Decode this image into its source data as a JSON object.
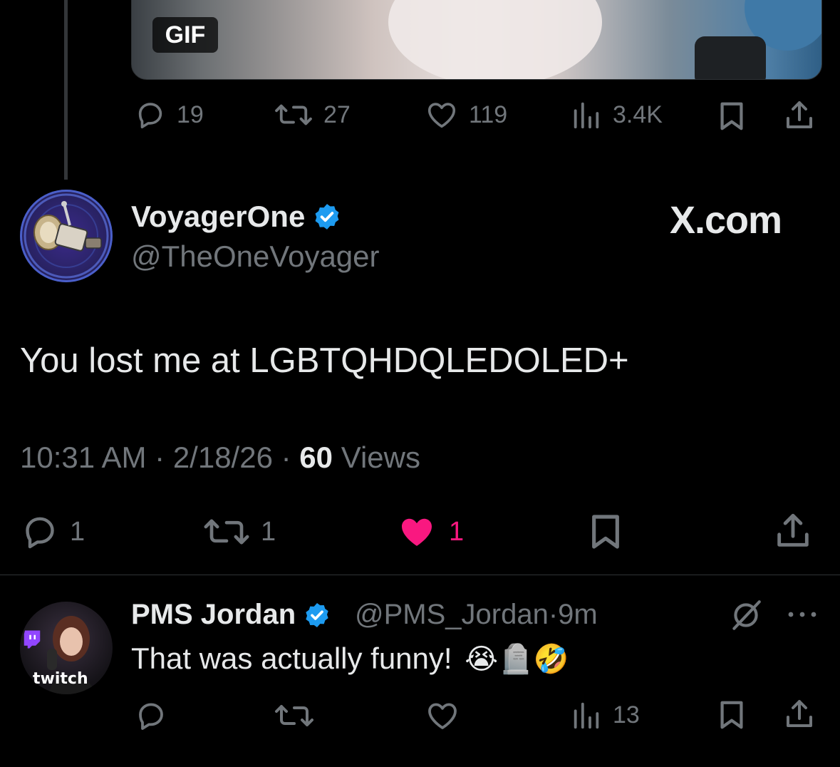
{
  "top_tweet": {
    "media_badge": "GIF",
    "actions": {
      "replies": "19",
      "reposts": "27",
      "likes": "119",
      "views": "3.4K"
    }
  },
  "main_tweet": {
    "display_name": "VoyagerOne",
    "handle": "@TheOneVoyager",
    "brand": "X.com",
    "text": "You lost me at LGBTQHDQLEDOLED+",
    "time": "10:31 AM",
    "date": "2/18/26",
    "views_count": "60",
    "views_label": "Views",
    "separator": "·",
    "actions": {
      "replies": "1",
      "reposts": "1",
      "likes": "1"
    },
    "like_color": "#f91880"
  },
  "reply": {
    "display_name": "PMS Jordan",
    "handle": "@PMS_Jordan",
    "separator": "·",
    "time": "9m",
    "text": "That was actually funny!",
    "emoji": "😭🪦🤣",
    "avatar_label": "twitch",
    "actions": {
      "views": "13"
    }
  },
  "colors": {
    "verified": "#1d9bf0",
    "muted": "#71767b",
    "twitch": "#9146ff"
  }
}
